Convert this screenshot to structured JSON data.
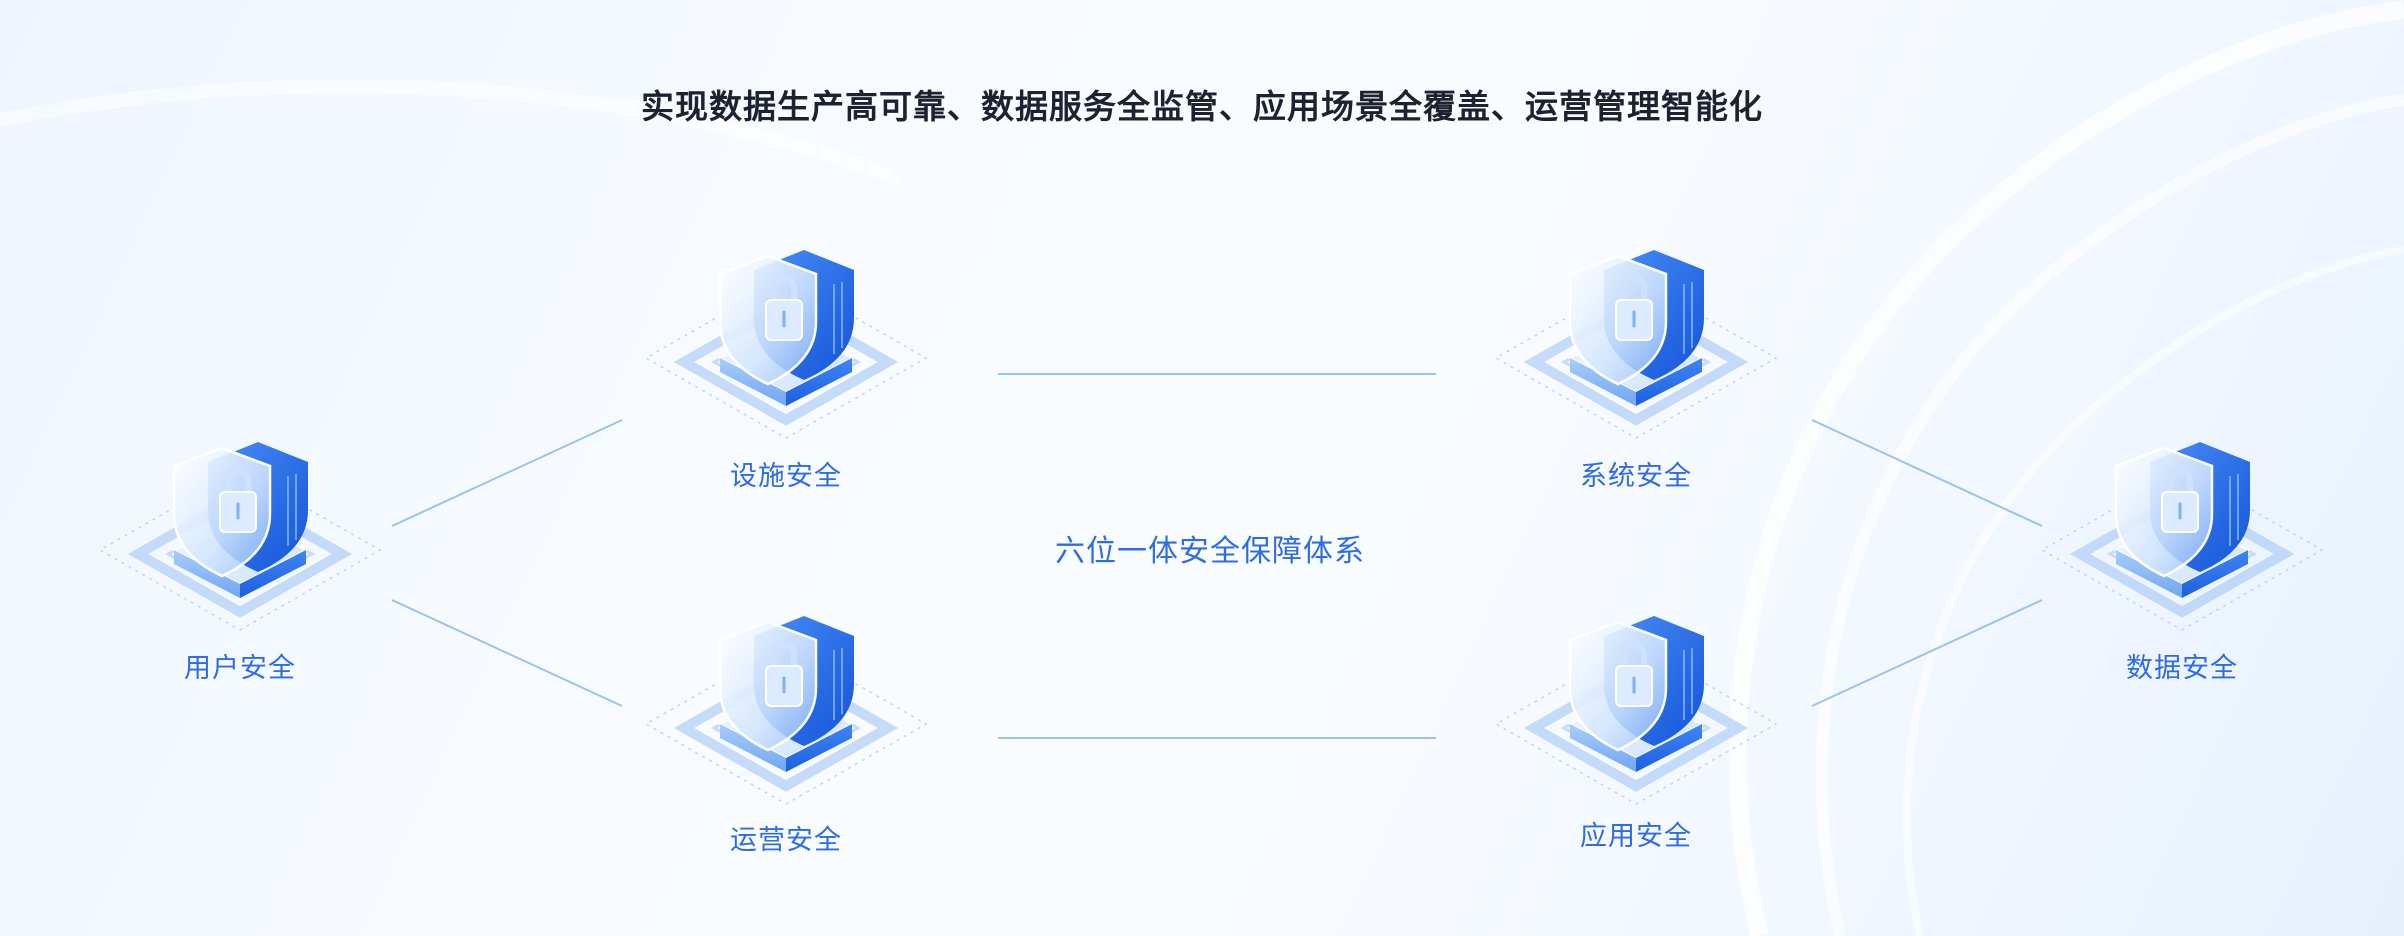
{
  "headline": "实现数据生产高可靠、数据服务全监管、应用场景全覆盖、运营管理智能化",
  "center_title": "六位一体安全保障体系",
  "colors": {
    "accent": "#2e6be6",
    "shield_blue": "#1f6ff0",
    "line": "#9cc1ee",
    "headline": "#1c2230"
  },
  "nodes": [
    {
      "id": "user",
      "label": "用户安全",
      "icon": "shield-lock-icon"
    },
    {
      "id": "facility",
      "label": "设施安全",
      "icon": "shield-lock-icon"
    },
    {
      "id": "operation",
      "label": "运营安全",
      "icon": "shield-lock-icon"
    },
    {
      "id": "system",
      "label": "系统安全",
      "icon": "shield-lock-icon"
    },
    {
      "id": "application",
      "label": "应用安全",
      "icon": "shield-lock-icon"
    },
    {
      "id": "data",
      "label": "数据安全",
      "icon": "shield-lock-icon"
    }
  ]
}
